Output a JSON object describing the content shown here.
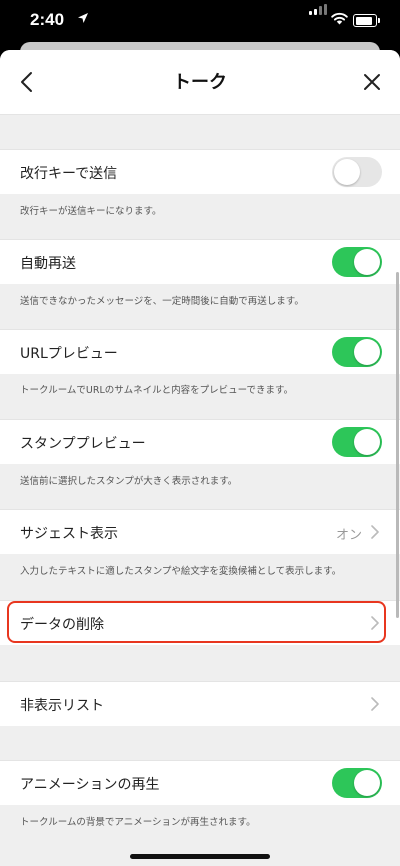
{
  "status_bar": {
    "time": "2:40"
  },
  "nav": {
    "title": "トーク"
  },
  "settings": {
    "enter_to_send": {
      "label": "改行キーで送信",
      "enabled": false,
      "description": "改行キーが送信キーになります。"
    },
    "auto_resend": {
      "label": "自動再送",
      "enabled": true,
      "description": "送信できなかったメッセージを、一定時間後に自動で再送します。"
    },
    "url_preview": {
      "label": "URLプレビュー",
      "enabled": true,
      "description": "トークルームでURLのサムネイルと内容をプレビューできます。"
    },
    "sticker_preview": {
      "label": "スタンププレビュー",
      "enabled": true,
      "description": "送信前に選択したスタンプが大きく表示されます。"
    },
    "suggest_display": {
      "label": "サジェスト表示",
      "value": "オン",
      "description": "入力したテキストに適したスタンプや絵文字を変換候補として表示します。"
    },
    "delete_data": {
      "label": "データの削除"
    },
    "hidden_list": {
      "label": "非表示リスト"
    },
    "animation_playback": {
      "label": "アニメーションの再生",
      "enabled": true,
      "description": "トークルームの背景でアニメーションが再生されます。"
    }
  },
  "colors": {
    "toggle_on": "#2dc659",
    "toggle_off": "#e6e6e6",
    "highlight": "#e8361f"
  }
}
